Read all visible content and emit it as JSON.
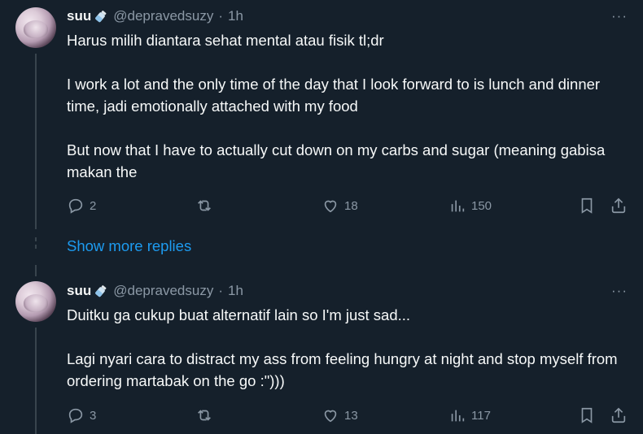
{
  "tweets": [
    {
      "name": "suu",
      "handle": "@depravedsuzy",
      "sep": "·",
      "time": "1h",
      "text": "Harus milih diantara sehat mental atau fisik tl;dr\n\nI work a lot and the only time of the day that I look forward to is lunch and dinner time, jadi emotionally attached with my food\n\nBut now that I have to actually cut down on my carbs and sugar (meaning gabisa makan the",
      "replies": "2",
      "retweets": "",
      "likes": "18",
      "views": "150"
    },
    {
      "name": "suu",
      "handle": "@depravedsuzy",
      "sep": "·",
      "time": "1h",
      "text": "Duitku ga cukup buat alternatif lain so I'm just sad...\n\nLagi nyari cara to distract my ass from feeling hungry at night and stop myself from ordering martabak on the go :\")))",
      "replies": "3",
      "retweets": "",
      "likes": "13",
      "views": "117"
    }
  ],
  "show_more_replies": "Show more replies",
  "more_glyph": "···",
  "colors": {
    "background": "#15202b",
    "accent": "#1d9bf0",
    "muted": "#8b98a5"
  }
}
